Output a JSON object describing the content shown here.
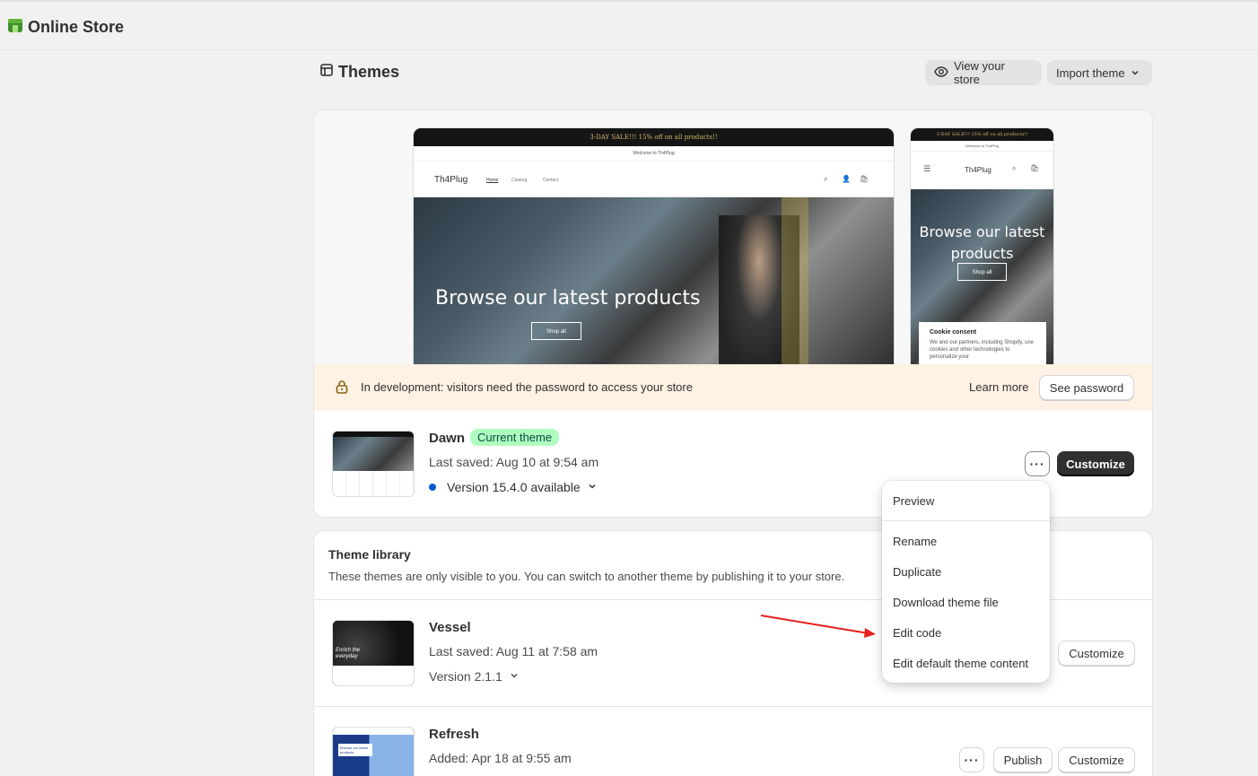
{
  "topbar": {
    "app_title": "Online Store"
  },
  "page": {
    "title": "Themes",
    "view_store": "View your store",
    "import_theme": "Import theme"
  },
  "preview": {
    "announcement": "3-DAY SALE!!! 15% off on all products!!",
    "welcome": "Welcome to Th4Plug",
    "store_name": "Th4Plug",
    "nav": [
      "Home",
      "Catalog",
      "Contact"
    ],
    "hero_title": "Browse our latest products",
    "hero_title_mobile_1": "Browse our latest",
    "hero_title_mobile_2": "products",
    "shop_all": "Shop all",
    "cookie_title": "Cookie consent",
    "cookie_text": "We and our partners, including Shopify, use cookies and other technologies to personalize your"
  },
  "banner": {
    "text": "In development: visitors need the password to access your store",
    "learn_more": "Learn more",
    "see_password": "See password"
  },
  "current_theme": {
    "name": "Dawn",
    "badge": "Current theme",
    "last_saved": "Last saved: Aug 10 at 9:54 am",
    "version": "Version 15.4.0 available",
    "customize": "Customize"
  },
  "library": {
    "title": "Theme library",
    "description": "These themes are only visible to you. You can switch to another theme by publishing it to your store.",
    "themes": [
      {
        "name": "Vessel",
        "meta": "Last saved: Aug 11 at 7:58 am",
        "version": "Version 2.1.1",
        "customize": "Customize",
        "thumb_text": "Enrich the everyday"
      },
      {
        "name": "Refresh",
        "meta": "Added: Apr 18 at 9:55 am",
        "publish": "Publish",
        "customize": "Customize",
        "thumb_text": "Browse our latest products"
      }
    ]
  },
  "menu": {
    "items": [
      "Preview",
      "Rename",
      "Duplicate",
      "Download theme file",
      "Edit code",
      "Edit default theme content"
    ]
  },
  "colors": {
    "accent_dark": "#303030",
    "badge_bg": "#affebf",
    "banner_bg": "#fff1e3",
    "version_dot": "#005bd3",
    "arrow": "#e5211c"
  }
}
